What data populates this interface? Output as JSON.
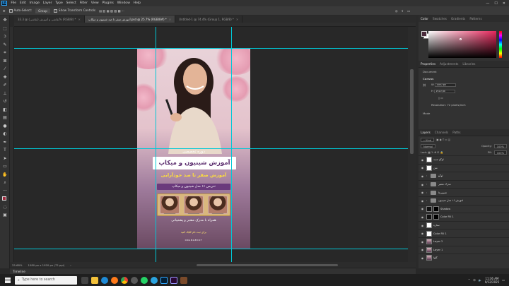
{
  "app": {
    "logo_text": "Ps",
    "menu": [
      "File",
      "Edit",
      "Image",
      "Layer",
      "Type",
      "Select",
      "Filter",
      "View",
      "Plugins",
      "Window",
      "Help"
    ],
    "window_controls": [
      "—",
      "☐",
      "✕"
    ]
  },
  "options_bar": {
    "auto_select_label": "Auto-Select:",
    "auto_select_value": "Group",
    "transform_label": "Show Transform Controls"
  },
  "tabs": [
    {
      "label": "نقاشی و آموزش (نقاشی) @ 33.3% (RGB/8) *",
      "active": false
    },
    {
      "label": "آموزش صفر تا صد شینیون و میکاپ.psd @ 25.7% (RGB/8#) *",
      "active": true
    },
    {
      "label": "Untitled-1 @ 74.4% (Group 1, RGB/8) *",
      "active": false
    }
  ],
  "status": {
    "zoom": "25.68%",
    "doc_size": "1080 px x 1920 px (72 ppi)"
  },
  "timeline_label": "Timeline",
  "poster": {
    "title_small": "دوره تخصصی",
    "title": "آموزش شینیون و میکاپ",
    "subtitle": "آموزش صفر تا صد خودآرایی",
    "line": "تدریس ۱۶ مدل شینیون و میکاپ",
    "footer": "همراه با مدرک معتبر و پشتیبانی",
    "footer2": "برای ثبت نام کلیک کنید",
    "brand": "ORANGEDOT"
  },
  "right_panel": {
    "color_tabs": [
      "Color",
      "Swatches",
      "Gradients",
      "Patterns"
    ],
    "fg_color": "#4b2c3c",
    "bg_color": "#ffffff",
    "props_tabs": [
      "Properties",
      "Adjustments",
      "Libraries"
    ],
    "props_document": "Document",
    "props_canvas": "Canvas",
    "width_label": "W",
    "width_value": "1080 px",
    "height_label": "H",
    "height_value": "1920 px",
    "resolution": "Resolution: 72 pixels/inch",
    "mode": "Mode",
    "layers_tabs": [
      "Layers",
      "Channels",
      "Paths"
    ],
    "kind_label": "Kind",
    "blend_mode": "Normal",
    "opacity_label": "Opacity:",
    "opacity_value": "100%",
    "fill_label": "Fill:",
    "fill_value": "100%",
    "layers": [
      {
        "name": "لوگو جدید",
        "type": "white"
      },
      {
        "name": "متن",
        "type": "white"
      },
      {
        "name": "لوگو",
        "type": "folder"
      },
      {
        "name": "مدرک معتبر",
        "type": "folder"
      },
      {
        "name": "تصویرها",
        "type": "folder"
      },
      {
        "name": "آموزش ۱۶ مدل شینیون",
        "type": "folder"
      },
      {
        "name": "Shadow",
        "type": "dark"
      },
      {
        "name": "Color Fill 1",
        "type": "dark"
      },
      {
        "name": "ستاره",
        "type": "white"
      },
      {
        "name": "Color Fill 1",
        "type": "white"
      },
      {
        "name": "Layer 2",
        "type": "img"
      },
      {
        "name": "Layer 1",
        "type": "img"
      },
      {
        "name": "گلها",
        "type": "img"
      }
    ]
  },
  "taskbar": {
    "search_placeholder": "Type here to search",
    "time": "11:36 AM",
    "date": "9/12/2025"
  }
}
